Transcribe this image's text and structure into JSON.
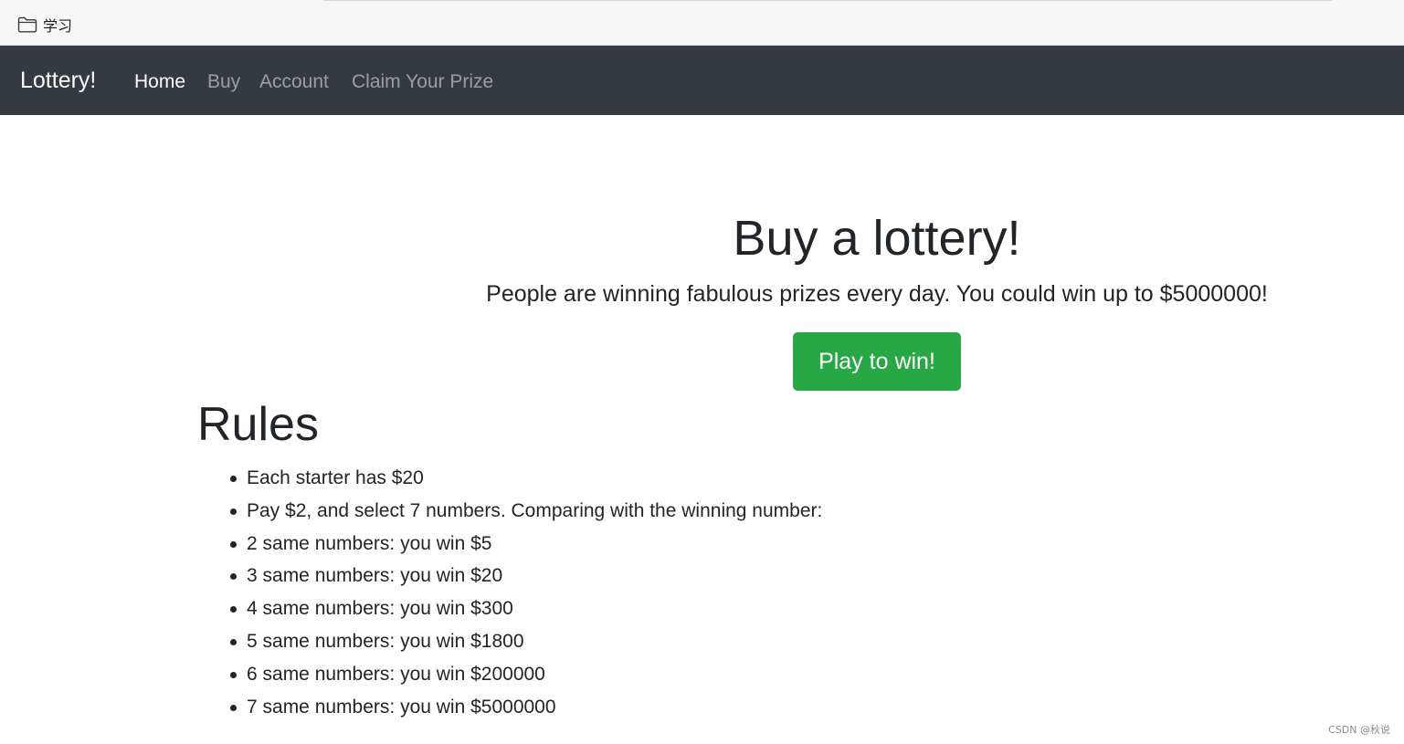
{
  "bookmarks": {
    "folder_label": "学习",
    "folder_icon": "folder-icon"
  },
  "navbar": {
    "brand": "Lottery!",
    "links": [
      {
        "label": "Home",
        "active": true
      },
      {
        "label": "Buy",
        "active": false
      },
      {
        "label": "Account",
        "active": false
      },
      {
        "label": "Claim Your Prize",
        "active": false
      }
    ],
    "background_color": "#343a40"
  },
  "jumbotron": {
    "title": "Buy a lottery!",
    "lead": "People are winning fabulous prizes every day. You could win up to $5000000!",
    "button_label": "Play to win!",
    "button_color": "#28a745"
  },
  "rules": {
    "title": "Rules",
    "items": [
      "Each starter has $20",
      "Pay $2, and select 7 numbers. Comparing with the winning number:",
      "2 same numbers: you win $5",
      "3 same numbers: you win $20",
      "4 same numbers: you win $300",
      "5 same numbers: you win $1800",
      "6 same numbers: you win $200000",
      "7 same numbers: you win $5000000"
    ]
  },
  "watermark": "CSDN @秋说"
}
